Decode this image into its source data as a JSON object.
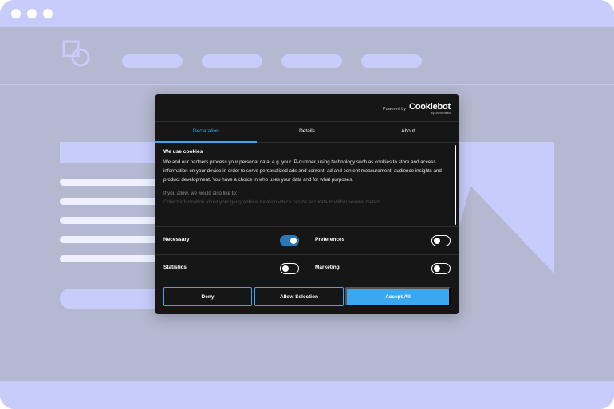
{
  "browser": {
    "window_controls": [
      "dot",
      "dot",
      "dot"
    ]
  },
  "site": {
    "nav_items": [
      "",
      "",
      "",
      ""
    ],
    "colors": {
      "placeholder": "#c8ccfb",
      "background": "#b4b8d0"
    }
  },
  "cookie_dialog": {
    "powered_by": "Powered by",
    "brand": "Cookiebot",
    "brand_sub": "by Usercentrics",
    "tabs": [
      {
        "label": "Declaration",
        "active": true
      },
      {
        "label": "Details",
        "active": false
      },
      {
        "label": "About",
        "active": false
      }
    ],
    "title": "We use cookies",
    "body": "We and our partners process your personal data, e.g. your IP-number, using technology such as cookies to store and access information on your device in order to serve personalized ads and content, ad and content measurement, audience insights and product development. You have a choice in who uses your data and for what purposes.",
    "subtitle": "If you allow, we would also like to:",
    "faded_line": "Collect information about your geographical location which can be accurate to within several meters",
    "toggles": {
      "necessary": {
        "label": "Necessary",
        "on": true
      },
      "preferences": {
        "label": "Preferences",
        "on": false
      },
      "statistics": {
        "label": "Statistics",
        "on": false
      },
      "marketing": {
        "label": "Marketing",
        "on": false
      }
    },
    "buttons": {
      "deny": "Deny",
      "allow_selection": "Allow Selection",
      "accept_all": "Accept All"
    },
    "colors": {
      "accent": "#3aa7ee",
      "toggle_on": "#2a78b8",
      "panel": "#161616"
    }
  }
}
